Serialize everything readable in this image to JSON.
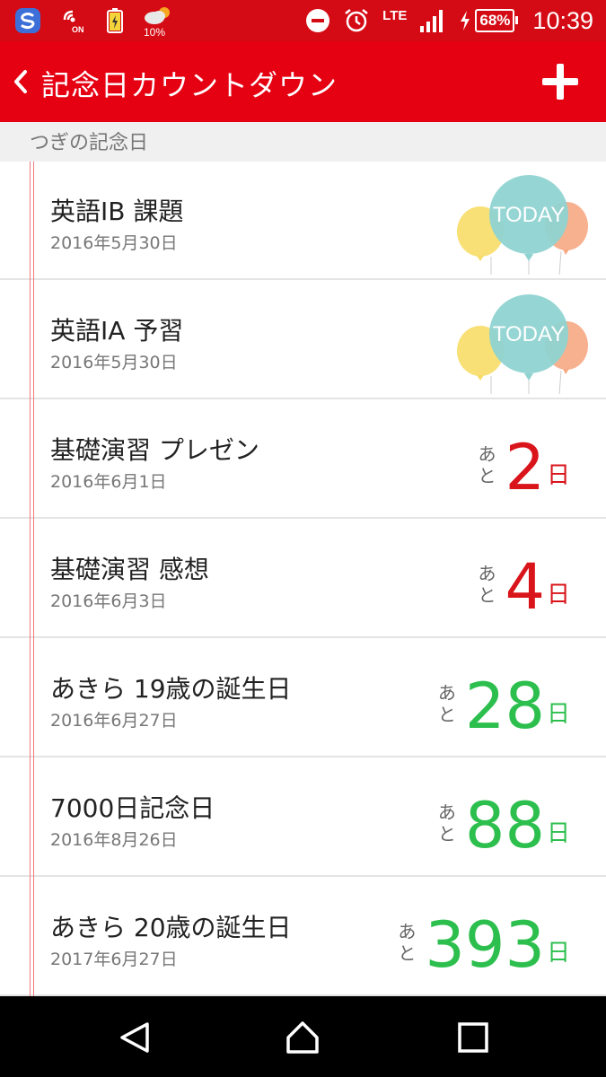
{
  "status_bar": {
    "weather_percent": "10%",
    "network": "LTE",
    "battery": "68%",
    "time": "10:39",
    "icons": [
      "s-app-icon",
      "nfc-on-icon",
      "battery-saver-icon",
      "weather-icon",
      "do-not-disturb-icon",
      "alarm-icon",
      "signal-icon",
      "charging-icon"
    ]
  },
  "app_bar": {
    "title": "記念日カウントダウン",
    "back_icon": "chevron-left-icon",
    "add_icon": "plus-icon"
  },
  "section": {
    "label": "つぎの記念日"
  },
  "events": [
    {
      "title": "英語IB 課題",
      "date": "2016年5月30日",
      "today": true,
      "badge": "TODAY"
    },
    {
      "title": "英語IA 予習",
      "date": "2016年5月30日",
      "today": true,
      "badge": "TODAY"
    },
    {
      "title": "基礎演習 プレゼン",
      "date": "2016年6月1日",
      "prefix": "あと",
      "days": "2",
      "unit": "日",
      "color": "#d9141b"
    },
    {
      "title": "基礎演習 感想",
      "date": "2016年6月3日",
      "prefix": "あと",
      "days": "4",
      "unit": "日",
      "color": "#d9141b"
    },
    {
      "title": "あきら 19歳の誕生日",
      "date": "2016年6月27日",
      "prefix": "あと",
      "days": "28",
      "unit": "日",
      "color": "#2dbf4e"
    },
    {
      "title": "7000日記念日",
      "date": "2016年8月26日",
      "prefix": "あと",
      "days": "88",
      "unit": "日",
      "color": "#2dbf4e"
    },
    {
      "title": "あきら 20歳の誕生日",
      "date": "2017年6月27日",
      "prefix": "あと",
      "days": "393",
      "unit": "日",
      "color": "#2dbf4e"
    }
  ],
  "nav_bar": {
    "icons": [
      "back-triangle-icon",
      "home-icon",
      "recents-icon"
    ]
  },
  "colors": {
    "app_bar": "#e50012",
    "status_bar": "#d40b14",
    "accent_red": "#d9141b",
    "accent_green": "#2dbf4e"
  }
}
